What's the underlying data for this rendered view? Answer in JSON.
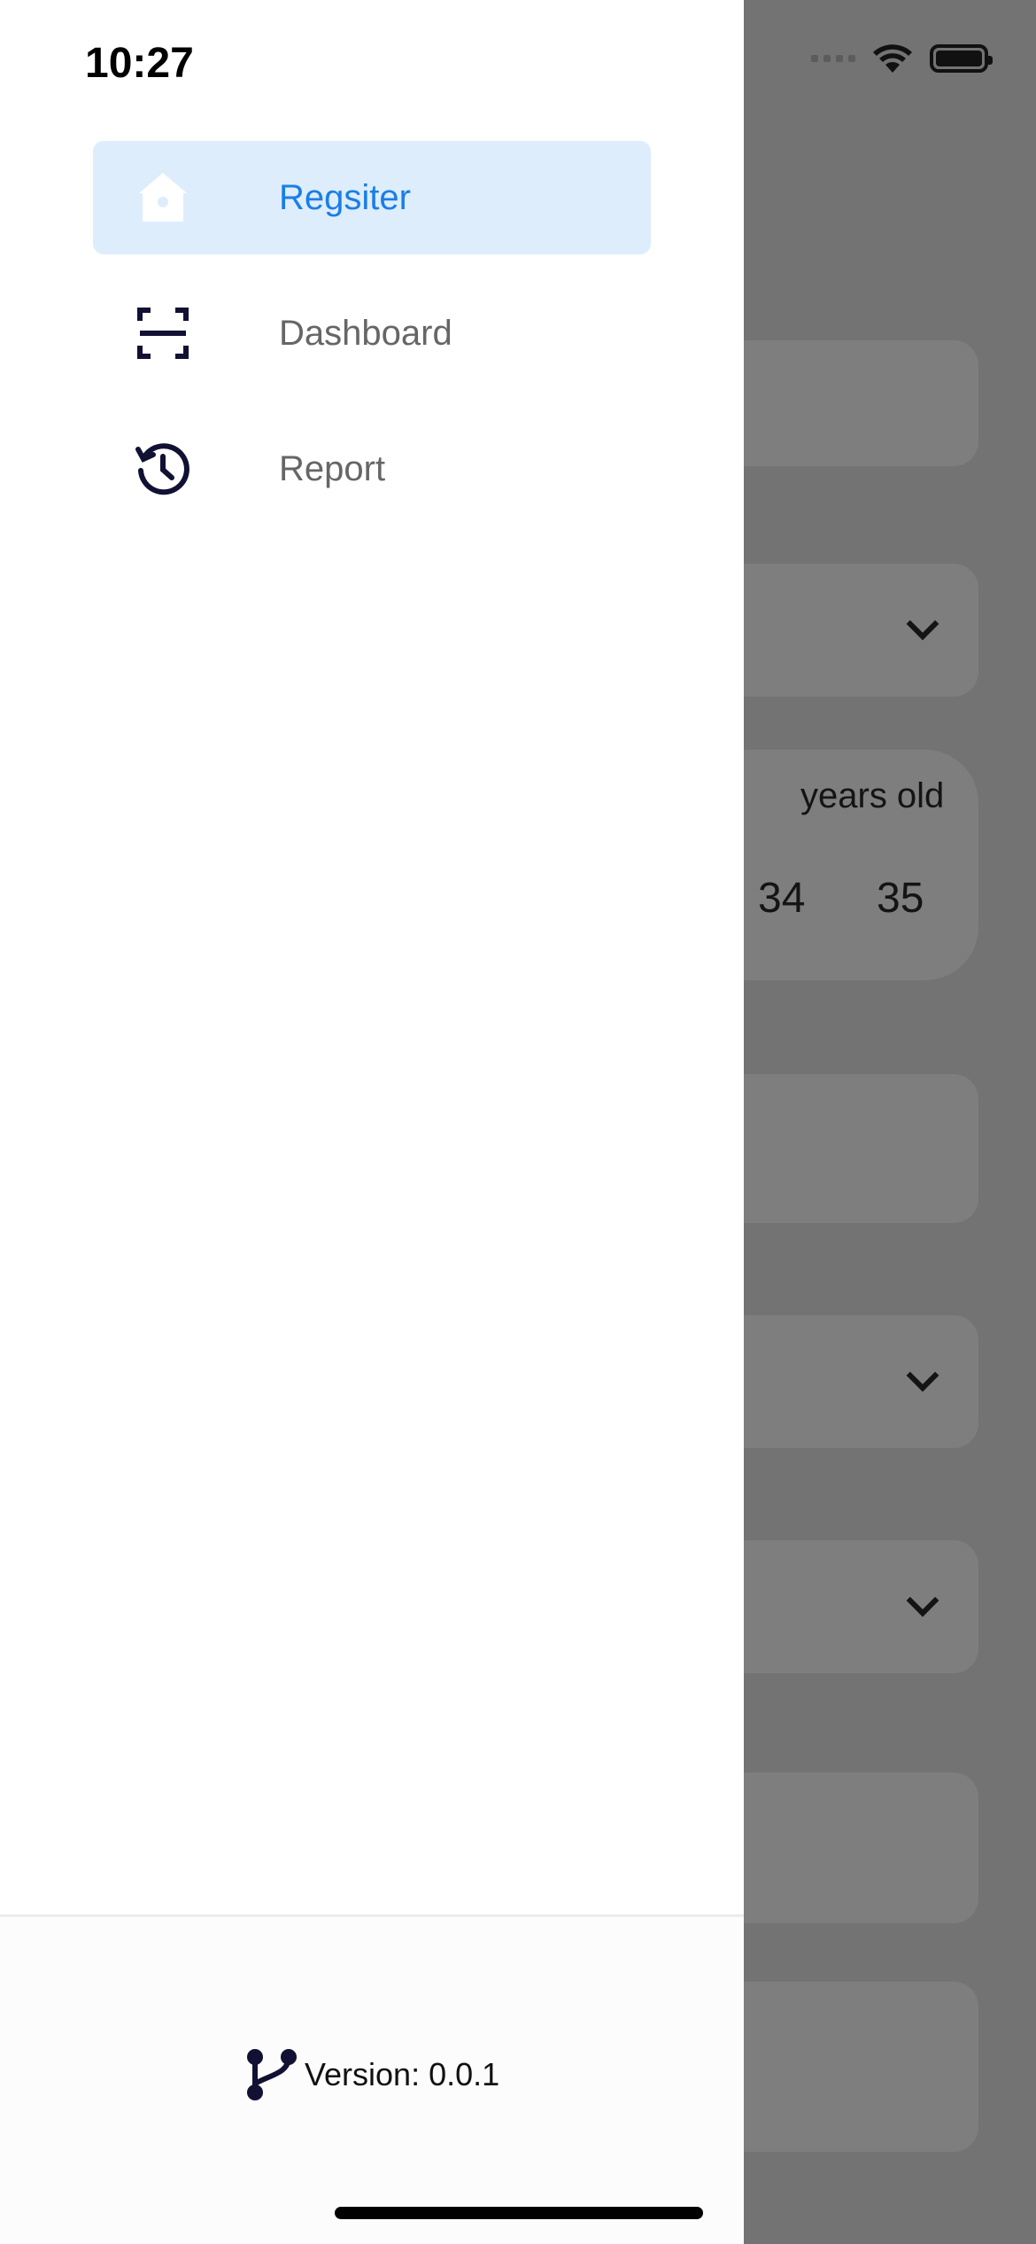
{
  "status_bar": {
    "time": "10:27"
  },
  "drawer": {
    "items": [
      {
        "label": "Regsiter",
        "icon": "home-icon",
        "active": true
      },
      {
        "label": "Dashboard",
        "icon": "scan-icon",
        "active": false
      },
      {
        "label": "Report",
        "icon": "history-icon",
        "active": false
      }
    ],
    "footer": {
      "version_text": "Version: 0.0.1",
      "icon": "git-branch-icon"
    }
  },
  "background": {
    "age_suffix": "years old",
    "age_options": [
      "34",
      "35"
    ]
  },
  "colors": {
    "active_bg": "#ddedfc",
    "active_text": "#1a7ee8",
    "icon": "#111133",
    "overlay": "#737373"
  }
}
